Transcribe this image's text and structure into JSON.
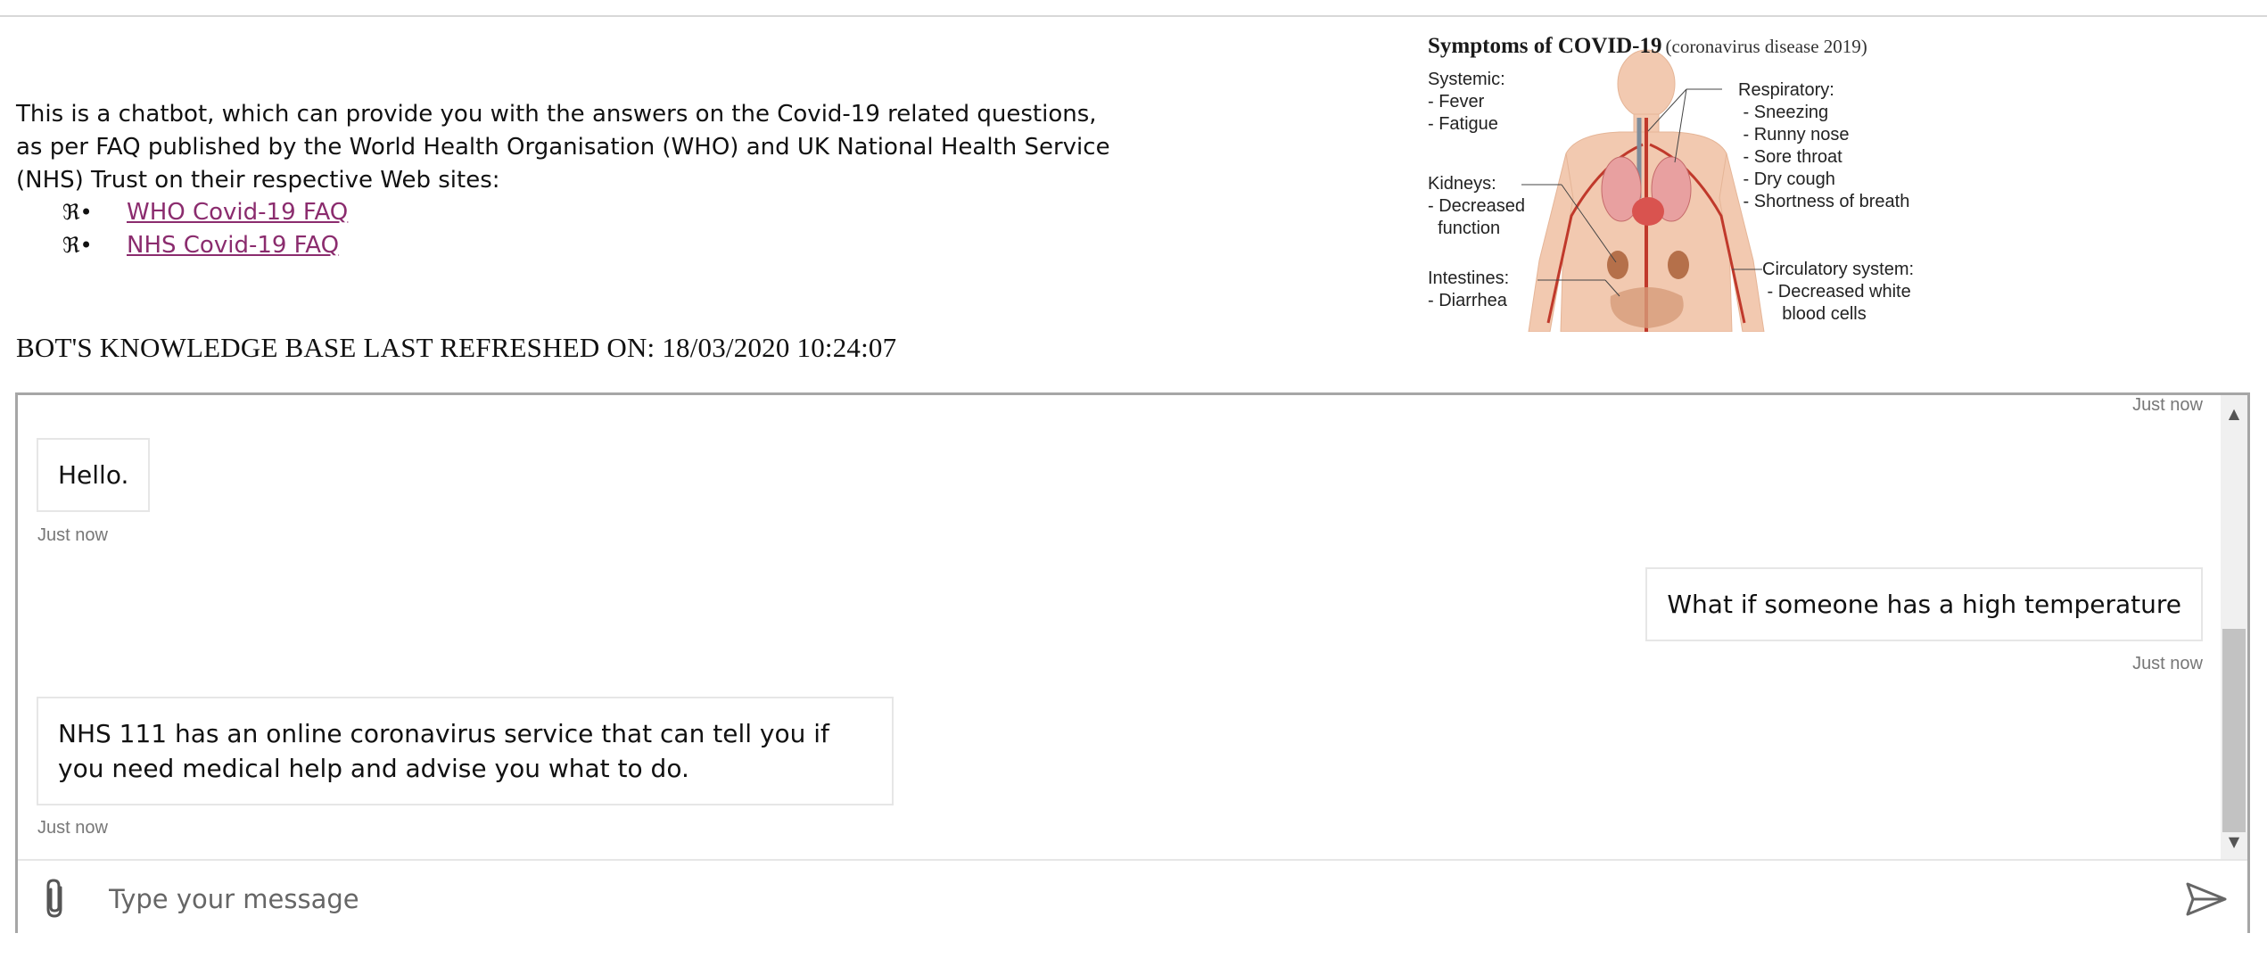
{
  "intro": {
    "text": "This is a chatbot, which can provide you with the answers on the Covid-19 related questions, as per FAQ published by the World Health Organisation (WHO) and UK National Health Service (NHS) Trust on their respective Web sites:",
    "bullet_glyph": "ℜ•",
    "links": [
      {
        "label": "WHO Covid-19 FAQ"
      },
      {
        "label": "NHS Covid-19 FAQ"
      }
    ]
  },
  "kb_refresh": "BOT'S KNOWLEDGE BASE LAST REFRESHED ON: 18/03/2020 10:24:07",
  "infographic": {
    "title": "Symptoms of COVID-19",
    "subtitle": "(coronavirus disease 2019)",
    "systemic": "Systemic:\n- Fever\n- Fatigue",
    "kidneys": "Kidneys:\n- Decreased\n  function",
    "intestines": "Intestines:\n- Diarrhea",
    "respiratory": "Respiratory:\n - Sneezing\n - Runny nose\n - Sore throat\n - Dry cough\n - Shortness of breath",
    "circulatory": "Circulatory system:\n - Decreased white\n    blood cells"
  },
  "chat": {
    "messages": [
      {
        "from": "bot",
        "text": "Hello.",
        "time": "Just now"
      },
      {
        "from": "user",
        "text": "What if someone has a high temperature",
        "time": "Just now"
      },
      {
        "from": "bot",
        "text": "NHS 111 has an online coronavirus service that can tell you if you need medical help and advise you what to do.",
        "time": "Just now"
      }
    ],
    "top_timestamp": "Just now",
    "input_placeholder": "Type your message",
    "icons": {
      "attach": "paperclip-icon",
      "send": "send-icon",
      "scroll_up": "scroll-up-icon",
      "scroll_down": "scroll-down-icon"
    }
  }
}
